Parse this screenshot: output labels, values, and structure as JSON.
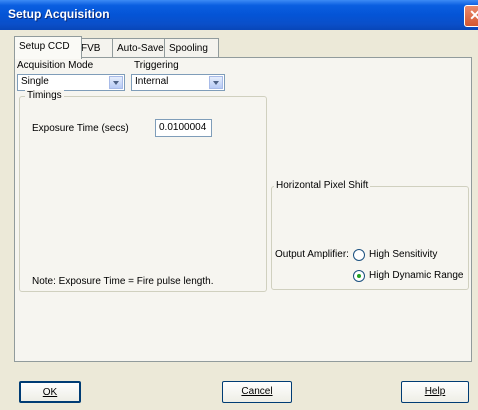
{
  "window": {
    "title": "Setup Acquisition",
    "close_glyph": "✕"
  },
  "tabs": [
    {
      "label": "Setup CCD"
    },
    {
      "label": "FVB"
    },
    {
      "label": "Auto-Save"
    },
    {
      "label": "Spooling"
    }
  ],
  "acquisition_mode": {
    "label": "Acquisition Mode",
    "value": "Single"
  },
  "triggering": {
    "label": "Triggering",
    "value": "Internal"
  },
  "timings": {
    "legend": "Timings",
    "exposure_label": "Exposure Time (secs)",
    "exposure_value": "0.0100004",
    "note": "Note: Exposure Time = Fire pulse length."
  },
  "pixel_shift": {
    "legend": "Horizontal Pixel Shift",
    "output_label": "Output Amplifier:",
    "options": [
      {
        "label": "High Sensitivity",
        "selected": false
      },
      {
        "label": "High Dynamic Range",
        "selected": true
      }
    ]
  },
  "buttons": {
    "ok": "OK",
    "cancel": "Cancel",
    "help": "Help"
  },
  "colors": {
    "titlebar": "#0454d6",
    "close": "#d3562f",
    "dialog_bg": "#ece9d8"
  }
}
